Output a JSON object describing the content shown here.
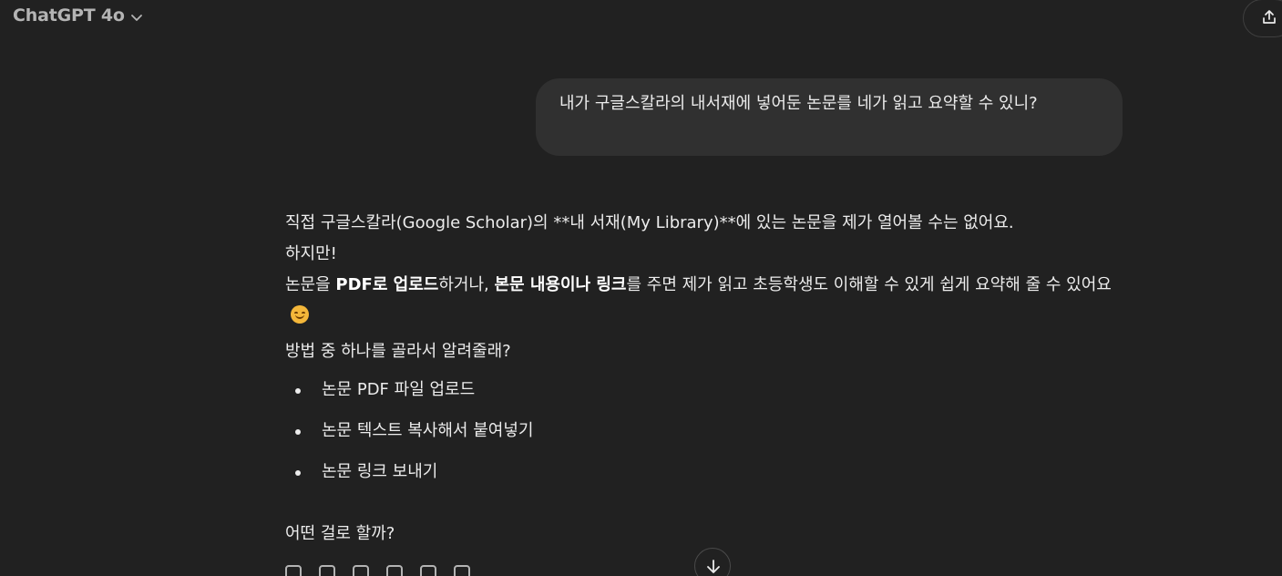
{
  "header": {
    "model_name": "ChatGPT 4o",
    "model_chevron_icon": "chevron-down-icon",
    "share_icon": "share-icon"
  },
  "user_message": {
    "text": "내가 구글스칼라의 내서재에 넣어둔 논문를 네가 읽고 요약할 수 있니?"
  },
  "assistant_message": {
    "p1": "직접 구글스칼라(Google Scholar)의 **내 서재(My Library)**에 있는 논문을 제가 열어볼 수는 없어요.",
    "p2": "하지만!",
    "p3_a": "논문을 ",
    "p3_b": "PDF로 업로드",
    "p3_c": "하거나, ",
    "p3_d": "본문 내용이나 링크",
    "p3_e": "를 주면 제가 읽고 초등학생도 이해할 수 있게 쉽게 요약해 줄 수 있어요",
    "p4": "방법 중 하나를 골라서 알려줄래?",
    "options": [
      "논문 PDF 파일 업로드",
      "논문 텍스트 복사해서 붙여넣기",
      "논문 링크 보내기"
    ],
    "closing": "어떤 걸로 할까?"
  },
  "actions": [
    "copy-icon",
    "thumbs-up-icon",
    "thumbs-down-icon",
    "read-aloud-icon",
    "edit-icon",
    "regenerate-icon"
  ],
  "scroll_button_icon": "arrow-down-icon"
}
